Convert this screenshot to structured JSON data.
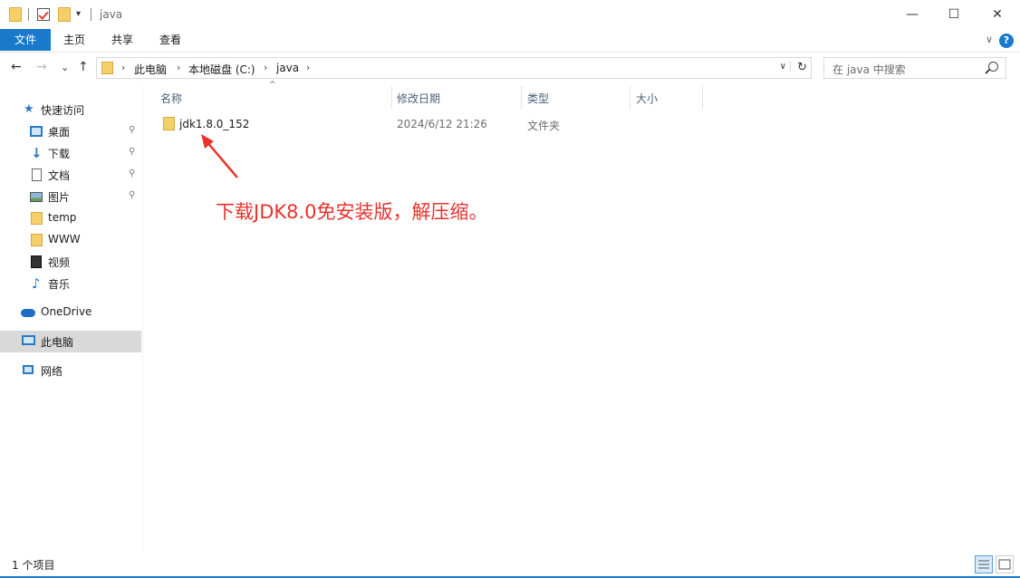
{
  "window": {
    "title": "java",
    "quick_access_dropdown": "▾",
    "minimize": "—",
    "maximize": "☐",
    "close": "✕"
  },
  "ribbon": {
    "tabs": [
      "文件",
      "主页",
      "共享",
      "查看"
    ],
    "expand": "∨",
    "help": "?"
  },
  "nav": {
    "back": "←",
    "forward": "→",
    "recent": "⌄",
    "up": "↑",
    "breadcrumbs": [
      "此电脑",
      "本地磁盘 (C:)",
      "java"
    ],
    "crumb_separator": "›",
    "dropdown": "∨",
    "refresh": "↻"
  },
  "search": {
    "placeholder": "在 java 中搜索"
  },
  "sidebar": {
    "items": [
      {
        "label": "快速访问",
        "icon": "star-icon"
      },
      {
        "label": "桌面",
        "icon": "desktop-icon",
        "pinned": true
      },
      {
        "label": "下载",
        "icon": "download-icon",
        "pinned": true
      },
      {
        "label": "文档",
        "icon": "document-icon",
        "pinned": true
      },
      {
        "label": "图片",
        "icon": "picture-icon",
        "pinned": true
      },
      {
        "label": "temp",
        "icon": "folder-icon"
      },
      {
        "label": "WWW",
        "icon": "folder-icon"
      },
      {
        "label": "视频",
        "icon": "video-icon"
      },
      {
        "label": "音乐",
        "icon": "music-icon"
      },
      {
        "label": "OneDrive",
        "icon": "cloud-icon"
      },
      {
        "label": "此电脑",
        "icon": "computer-icon",
        "selected": true
      },
      {
        "label": "网络",
        "icon": "network-icon"
      }
    ],
    "pin_glyph": "📌"
  },
  "columns": [
    "名称",
    "修改日期",
    "类型",
    "大小"
  ],
  "sort_indicator": "^",
  "files": [
    {
      "name": "jdk1.8.0_152",
      "modified": "2024/6/12 21:26",
      "type": "文件夹",
      "size": ""
    }
  ],
  "annotation": "下载JDK8.0免安装版，解压缩。",
  "status": {
    "count_text": "1 个项目"
  },
  "colors": {
    "accent": "#1979ca",
    "annotation": "#e8322c",
    "folder": "#f5cf6a",
    "selected_bg": "#d9d9d9"
  }
}
